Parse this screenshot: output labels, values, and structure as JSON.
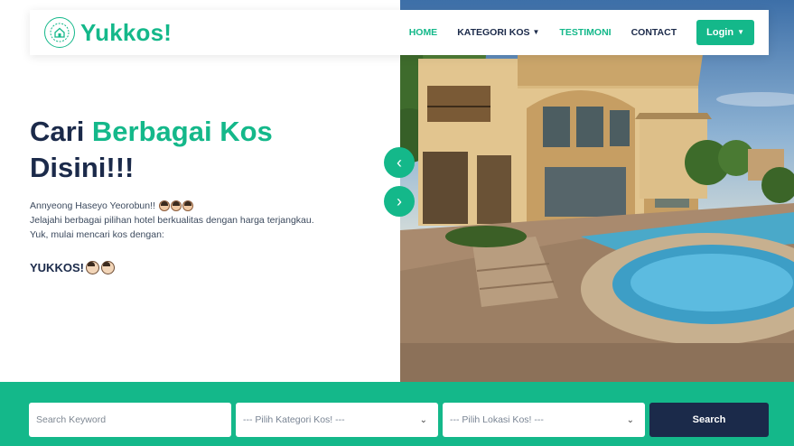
{
  "brand": {
    "name": "Yukkos!",
    "logo_icon": "home-badge-icon"
  },
  "nav": {
    "items": [
      {
        "label": "HOME",
        "active": true,
        "has_dropdown": false
      },
      {
        "label": "KATEGORI KOS",
        "active": false,
        "has_dropdown": true
      },
      {
        "label": "TESTIMONI",
        "active": true,
        "has_dropdown": false
      },
      {
        "label": "CONTACT",
        "active": false,
        "has_dropdown": false
      }
    ],
    "login_label": "Login"
  },
  "hero": {
    "title_part1": "Cari ",
    "title_accent": "Berbagai Kos",
    "title_part2": "Disini!!!",
    "desc_line1": "Annyeong Haseyo Yeorobun!!",
    "desc_line2": "Jelajahi berbagai pilihan hotel berkualitas dengan harga terjangkau.",
    "desc_line3": "Yuk, mulai mencari kos dengan:",
    "brand_line": "YUKKOS!",
    "image_alt": "villa-with-pool-image"
  },
  "carousel": {
    "prev_icon": "chevron-left-icon",
    "next_icon": "chevron-right-icon"
  },
  "search": {
    "keyword_placeholder": "Search Keyword",
    "kategori_value": "--- Pilih Kategori Kos! ---",
    "lokasi_value": "--- Pilih Lokasi Kos! ---",
    "button_label": "Search"
  },
  "colors": {
    "accent": "#14b88a",
    "navy": "#1b2a4a"
  }
}
